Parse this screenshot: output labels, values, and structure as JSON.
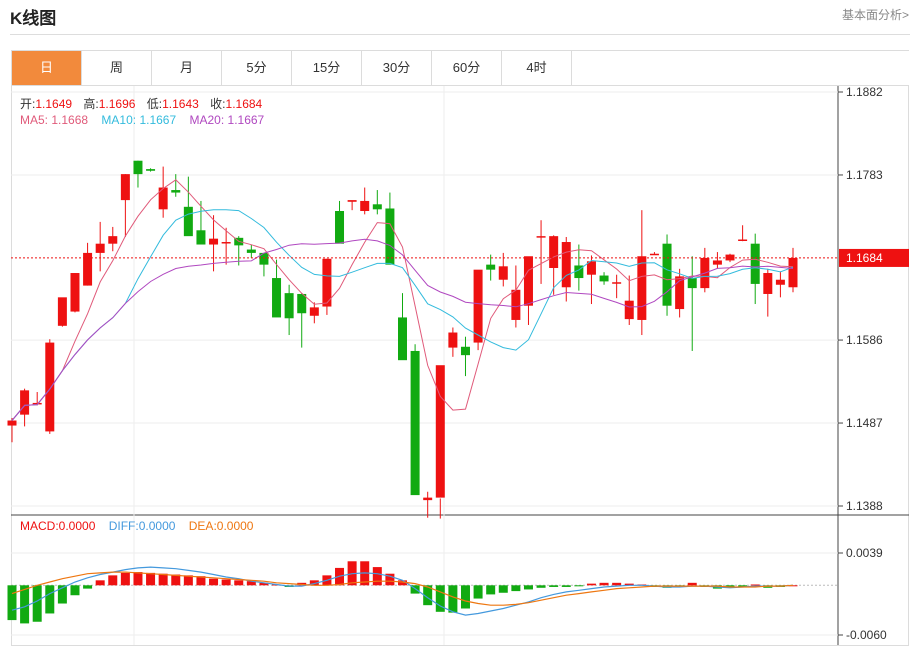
{
  "header": {
    "title": "K线图",
    "fundamental_link": "基本面分析>"
  },
  "tabs": [
    {
      "label": "日",
      "active": true
    },
    {
      "label": "周",
      "active": false
    },
    {
      "label": "月",
      "active": false
    },
    {
      "label": "5分",
      "active": false
    },
    {
      "label": "15分",
      "active": false
    },
    {
      "label": "30分",
      "active": false
    },
    {
      "label": "60分",
      "active": false
    },
    {
      "label": "4时",
      "active": false
    }
  ],
  "ohlc_legend": {
    "open_label": "开:",
    "open": "1.1649",
    "high_label": "高:",
    "high": "1.1696",
    "low_label": "低:",
    "low": "1.1643",
    "close_label": "收:",
    "close": "1.1684"
  },
  "ma_legend": {
    "ma5_label": "MA5:",
    "ma5": "1.1668",
    "ma10_label": "MA10:",
    "ma10": "1.1667",
    "ma20_label": "MA20:",
    "ma20": "1.1667"
  },
  "macd_legend": {
    "macd_label": "MACD:",
    "macd": "0.0000",
    "diff_label": "DIFF:",
    "diff": "0.0000",
    "dea_label": "DEA:",
    "dea": "0.0000"
  },
  "colors": {
    "up": "#ee1111",
    "down": "#11aa11",
    "ma5": "#e05a7a",
    "ma10": "#33bbdd",
    "ma20": "#b048c0",
    "diff": "#4499dd",
    "dea": "#ee7711",
    "accent": "#f28a3c"
  },
  "chart_data": {
    "type": "candlestick",
    "price_axis": {
      "ticks": [
        1.1882,
        1.1783,
        1.1586,
        1.1487,
        1.1388
      ],
      "range": [
        1.1388,
        1.1882
      ],
      "current": 1.1684,
      "current_label": "1.1684"
    },
    "macd_axis": {
      "ticks": [
        0.0039,
        -0.006
      ],
      "tick_labels": [
        "0.0039",
        "-0.0060"
      ],
      "range": [
        -0.006,
        0.0039
      ]
    },
    "candles": [
      [
        1.1484,
        1.1493,
        1.1464,
        1.149
      ],
      [
        1.1497,
        1.1528,
        1.1483,
        1.1526
      ],
      [
        1.1511,
        1.1524,
        1.1508,
        1.1511
      ],
      [
        1.1477,
        1.1587,
        1.1474,
        1.1583
      ],
      [
        1.1603,
        1.1606,
        1.1602,
        1.1637
      ],
      [
        1.162,
        1.1666,
        1.1619,
        1.1666
      ],
      [
        1.1651,
        1.1702,
        1.1651,
        1.169
      ],
      [
        1.169,
        1.1727,
        1.1668,
        1.1701
      ],
      [
        1.1701,
        1.1721,
        1.1692,
        1.171
      ],
      [
        1.1753,
        1.1784,
        1.1709,
        1.1784
      ],
      [
        1.18,
        1.18,
        1.1768,
        1.1784
      ],
      [
        1.179,
        1.1791,
        1.1787,
        1.1788
      ],
      [
        1.1742,
        1.1793,
        1.1732,
        1.1768
      ],
      [
        1.1765,
        1.1784,
        1.1757,
        1.1762
      ],
      [
        1.1745,
        1.1781,
        1.174,
        1.171
      ],
      [
        1.1717,
        1.1752,
        1.1711,
        1.17
      ],
      [
        1.17,
        1.1735,
        1.1668,
        1.1707
      ],
      [
        1.1703,
        1.172,
        1.1676,
        1.1703
      ],
      [
        1.1708,
        1.171,
        1.1675,
        1.1699
      ],
      [
        1.1694,
        1.17,
        1.1684,
        1.169
      ],
      [
        1.169,
        1.1683,
        1.1662,
        1.1676
      ],
      [
        1.166,
        1.1682,
        1.1645,
        1.1613
      ],
      [
        1.1642,
        1.1652,
        1.1592,
        1.1612
      ],
      [
        1.1641,
        1.1642,
        1.1577,
        1.1618
      ],
      [
        1.1615,
        1.1631,
        1.1606,
        1.1625
      ],
      [
        1.1626,
        1.1683,
        1.1616,
        1.1683
      ],
      [
        1.174,
        1.1752,
        1.1704,
        1.1701
      ],
      [
        1.1751,
        1.1752,
        1.1741,
        1.1753
      ],
      [
        1.174,
        1.1768,
        1.1736,
        1.1752
      ],
      [
        1.1748,
        1.1765,
        1.1736,
        1.1742
      ],
      [
        1.1743,
        1.1762,
        1.1726,
        1.1676
      ],
      [
        1.1613,
        1.1642,
        1.1576,
        1.1562
      ],
      [
        1.1573,
        1.1581,
        1.1403,
        1.1401
      ],
      [
        1.1395,
        1.1405,
        1.1374,
        1.1398
      ],
      [
        1.1398,
        1.1397,
        1.1373,
        1.1556
      ],
      [
        1.1577,
        1.1601,
        1.1566,
        1.1595
      ],
      [
        1.1578,
        1.159,
        1.1543,
        1.1568
      ],
      [
        1.1583,
        1.16,
        1.1574,
        1.167
      ],
      [
        1.1676,
        1.1688,
        1.1657,
        1.167
      ],
      [
        1.1658,
        1.169,
        1.165,
        1.1674
      ],
      [
        1.161,
        1.1675,
        1.1601,
        1.1646
      ],
      [
        1.1627,
        1.1685,
        1.1604,
        1.1686
      ],
      [
        1.171,
        1.1729,
        1.1653,
        1.171
      ],
      [
        1.1672,
        1.1711,
        1.164,
        1.171
      ],
      [
        1.1649,
        1.1709,
        1.1632,
        1.1703
      ],
      [
        1.1675,
        1.17,
        1.1645,
        1.166
      ],
      [
        1.1664,
        1.1687,
        1.1629,
        1.168
      ],
      [
        1.1663,
        1.1667,
        1.1652,
        1.1656
      ],
      [
        1.1654,
        1.1664,
        1.1636,
        1.1655
      ],
      [
        1.1611,
        1.1663,
        1.1604,
        1.1633
      ],
      [
        1.161,
        1.1741,
        1.1592,
        1.1686
      ],
      [
        1.1689,
        1.1691,
        1.1688,
        1.1689
      ],
      [
        1.1701,
        1.1712,
        1.1615,
        1.1627
      ],
      [
        1.1623,
        1.1671,
        1.1613,
        1.1662
      ],
      [
        1.166,
        1.1686,
        1.1573,
        1.1648
      ],
      [
        1.1648,
        1.1696,
        1.1643,
        1.1684
      ],
      [
        1.1676,
        1.1691,
        1.1671,
        1.1681
      ],
      [
        1.1681,
        1.1689,
        1.1679,
        1.1688
      ],
      [
        1.1706,
        1.1723,
        1.1704,
        1.1706
      ],
      [
        1.1701,
        1.1713,
        1.1629,
        1.1653
      ],
      [
        1.1641,
        1.1671,
        1.1614,
        1.1666
      ],
      [
        1.1652,
        1.1668,
        1.1637,
        1.1658
      ],
      [
        1.1649,
        1.1696,
        1.1643,
        1.1684
      ]
    ],
    "macd_hist": [
      -0.0042,
      -0.0046,
      -0.0044,
      -0.0034,
      -0.0022,
      -0.0012,
      -0.0004,
      0.0006,
      0.0012,
      0.0015,
      0.0016,
      0.0015,
      0.0014,
      0.0013,
      0.0012,
      0.0011,
      0.0008,
      0.0007,
      0.0006,
      0.0005,
      0.0003,
      0.0001,
      -0.0002,
      0.0003,
      0.0006,
      0.0012,
      0.0021,
      0.0029,
      0.0029,
      0.0022,
      0.0014,
      0.0006,
      -0.001,
      -0.0024,
      -0.0032,
      -0.0033,
      -0.0028,
      -0.0016,
      -0.0011,
      -0.0009,
      -0.0007,
      -0.0005,
      -0.0003,
      -0.0002,
      -0.0002,
      -0.0001,
      0.0002,
      0.0003,
      0.0003,
      0.0002,
      0.0001,
      -0.0002,
      -0.0003,
      -0.0002,
      0.0003,
      -0.0002,
      -0.0004,
      -0.0003,
      -0.0002,
      0.0001,
      -0.0003,
      -0.0002,
      0.0
    ],
    "diff": [
      -0.003,
      -0.0026,
      -0.0019,
      -0.001,
      -0.0003,
      0.0004,
      0.0009,
      0.0013,
      0.0016,
      0.0019,
      0.0021,
      0.0022,
      0.0021,
      0.002,
      0.0018,
      0.0016,
      0.0013,
      0.001,
      0.0008,
      0.0005,
      0.0003,
      0.0001,
      -0.0001,
      -0.0001,
      0.0002,
      0.0006,
      0.0011,
      0.0014,
      0.0015,
      0.0014,
      0.0011,
      0.0006,
      -0.0004,
      -0.0015,
      -0.0025,
      -0.0032,
      -0.0036,
      -0.0034,
      -0.0031,
      -0.0028,
      -0.0024,
      -0.002,
      -0.0015,
      -0.0011,
      -0.0008,
      -0.0006,
      -0.0004,
      -0.0002,
      -0.0001,
      0.0,
      0.0,
      -0.0001,
      -0.0002,
      -0.0002,
      -0.0001,
      -0.0001,
      -0.0002,
      -0.0003,
      -0.0002,
      -0.0001,
      -0.0001,
      -0.0001,
      0.0
    ],
    "dea": [
      -0.001,
      -0.0005,
      0.0,
      0.0004,
      0.0008,
      0.0011,
      0.0014,
      0.0015,
      0.0016,
      0.0016,
      0.0015,
      0.0014,
      0.0013,
      0.0012,
      0.0011,
      0.001,
      0.0009,
      0.0008,
      0.0007,
      0.0006,
      0.0005,
      0.0003,
      0.0002,
      0.0001,
      0.0,
      0.0,
      0.0001,
      0.0003,
      0.0004,
      0.0005,
      0.0005,
      0.0004,
      0.0002,
      -0.0002,
      -0.0008,
      -0.0014,
      -0.0019,
      -0.0022,
      -0.0024,
      -0.0024,
      -0.0023,
      -0.0021,
      -0.0018,
      -0.0015,
      -0.0012,
      -0.001,
      -0.0008,
      -0.0006,
      -0.0004,
      -0.0003,
      -0.0002,
      -0.0001,
      -0.0001,
      -0.0001,
      -0.0001,
      -0.0001,
      -0.0001,
      -0.0002,
      -0.0002,
      -0.0002,
      -0.0001,
      -0.0001,
      0.0
    ]
  }
}
